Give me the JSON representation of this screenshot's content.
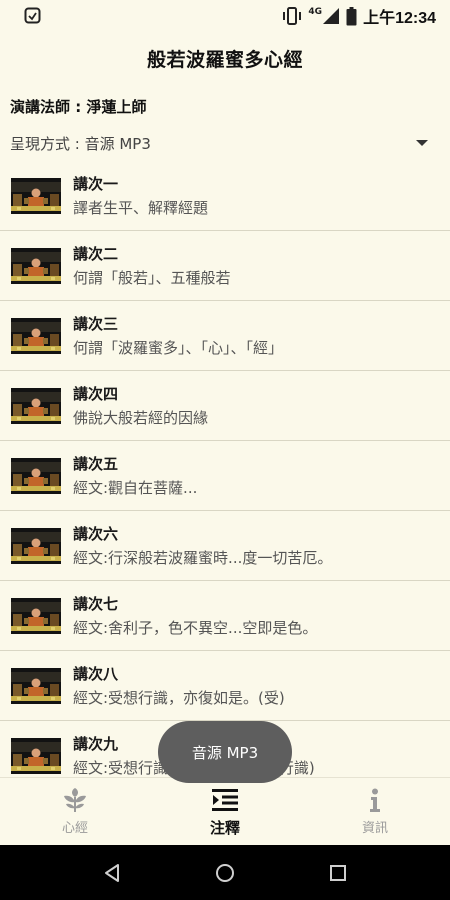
{
  "status_bar": {
    "network": "4G",
    "time": "上午12:34"
  },
  "app": {
    "title": "般若波羅蜜多心經"
  },
  "lecturer": "演講法師 : 淨蓮上師",
  "format": {
    "label": "呈現方式 : 音源 MP3",
    "selected": "音源 MP3"
  },
  "lectures": [
    {
      "title": "講次一",
      "desc": "譯者生平、解釋經題"
    },
    {
      "title": "講次二",
      "desc": "何謂「般若」、五種般若"
    },
    {
      "title": "講次三",
      "desc": "何謂「波羅蜜多」、「心」、「經」"
    },
    {
      "title": "講次四",
      "desc": "佛說大般若經的因緣"
    },
    {
      "title": "講次五",
      "desc": "經文:觀自在菩薩..."
    },
    {
      "title": "講次六",
      "desc": "經文:行深般若波羅蜜時...度一切苦厄。"
    },
    {
      "title": "講次七",
      "desc": "經文:舍利子，色不異空...空即是色。"
    },
    {
      "title": "講次八",
      "desc": "經文:受想行識，亦復如是。(受)"
    },
    {
      "title": "講次九",
      "desc": "經文:受想行識，亦復如是。(想行識)"
    }
  ],
  "toast": "音源 MP3",
  "bottom_nav": [
    {
      "label": "心經",
      "icon": "leaf-icon",
      "active": false
    },
    {
      "label": "注釋",
      "icon": "indent-list-icon",
      "active": true
    },
    {
      "label": "資訊",
      "icon": "info-icon",
      "active": false
    }
  ],
  "colors": {
    "background": "#fbf9ea",
    "divider": "#d9d6c4",
    "toast": "#5e5e5e",
    "inactive_nav": "#9a9a9a"
  }
}
